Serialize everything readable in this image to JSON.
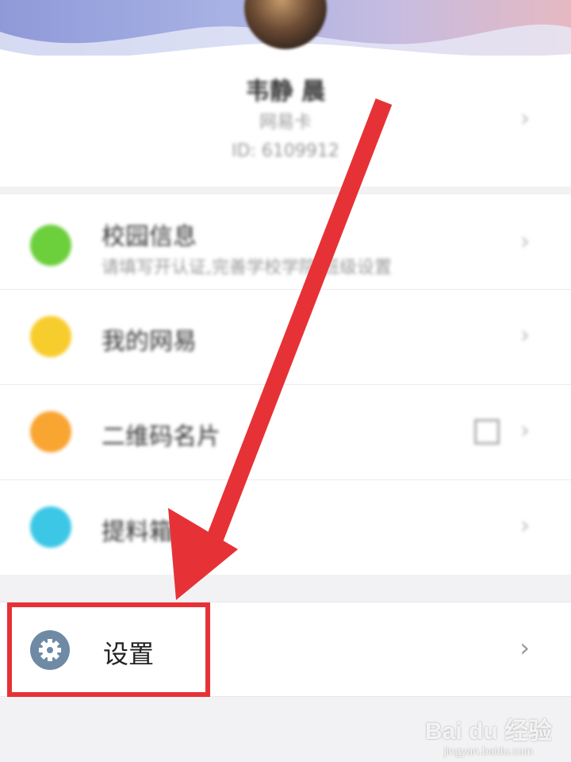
{
  "profile": {
    "name": "韦静 晨",
    "subtitle": "网易卡",
    "id_text": "ID: 6109912"
  },
  "menu": [
    {
      "title": "校园信息",
      "desc": "请填写开认证,完善学校学院,班级设置",
      "icon": "campus-icon",
      "color": "#6ccf3c"
    },
    {
      "title": "我的网易",
      "desc": "",
      "icon": "netease-icon",
      "color": "#f7cd2e"
    },
    {
      "title": "二维码名片",
      "desc": "",
      "icon": "qr-card-icon",
      "color": "#f9a532"
    },
    {
      "title": "提料箱",
      "desc": "",
      "icon": "box-icon",
      "color": "#3cc7e6"
    }
  ],
  "settings": {
    "label": "设置",
    "icon": "gear-icon",
    "icon_color": "#6f8aa5"
  },
  "annotation": {
    "arrow_color": "#e63236"
  },
  "watermark": {
    "logo": "Bai du 经验",
    "url": "jingyan.baidu.com"
  },
  "chevron": "›"
}
